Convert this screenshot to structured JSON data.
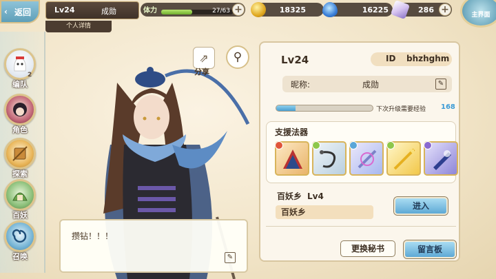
{
  "top_bar": {
    "back_label": "返回",
    "player_level": "Lv24",
    "player_name": "成勋",
    "detail_tab": "个人详情",
    "stamina": {
      "label": "体力",
      "value": "27/63",
      "fraction": 0.43
    },
    "gold": "18325",
    "gems": "16225",
    "crystals": "286",
    "main_label": "主界面"
  },
  "left_nav": {
    "items": [
      {
        "label": "编队",
        "icon": "ghost-mascot-icon"
      },
      {
        "label": "角色",
        "icon": "character-portrait-icon"
      },
      {
        "label": "探索",
        "icon": "explore-tools-icon"
      },
      {
        "label": "百妖",
        "icon": "demon-encyclopedia-icon"
      },
      {
        "label": "召唤",
        "icon": "summon-swirl-icon"
      }
    ],
    "badge": "2"
  },
  "character": {
    "share_label": "分享",
    "speech": "攒钻！！！"
  },
  "panel": {
    "level": "Lv24",
    "id_label": "ID",
    "id_value": "bhzhghm",
    "nickname_label": "昵称:",
    "nickname_value": "成勋",
    "xp_fraction": 0.2,
    "xp_label": "下次升级需要经验",
    "xp_value": "168",
    "support_title": "支援法器",
    "artifacts": [
      {
        "icon": "fan-artifact-icon",
        "badge_color": "#e0553a"
      },
      {
        "icon": "whip-artifact-icon",
        "badge_color": "#8ec74a"
      },
      {
        "icon": "spiral-sword-artifact-icon",
        "badge_color": "#5aa6d8"
      },
      {
        "icon": "golden-spear-artifact-icon",
        "badge_color": "#8ec74a"
      },
      {
        "icon": "blue-blade-artifact-icon",
        "badge_color": "#8a6ad0"
      }
    ],
    "demon_village_label": "百妖乡",
    "demon_village_level": "Lv4",
    "demon_village_name": "百妖乡",
    "enter_label": "进入",
    "change_secretary_label": "更换秘书",
    "message_board_label": "留言板"
  }
}
